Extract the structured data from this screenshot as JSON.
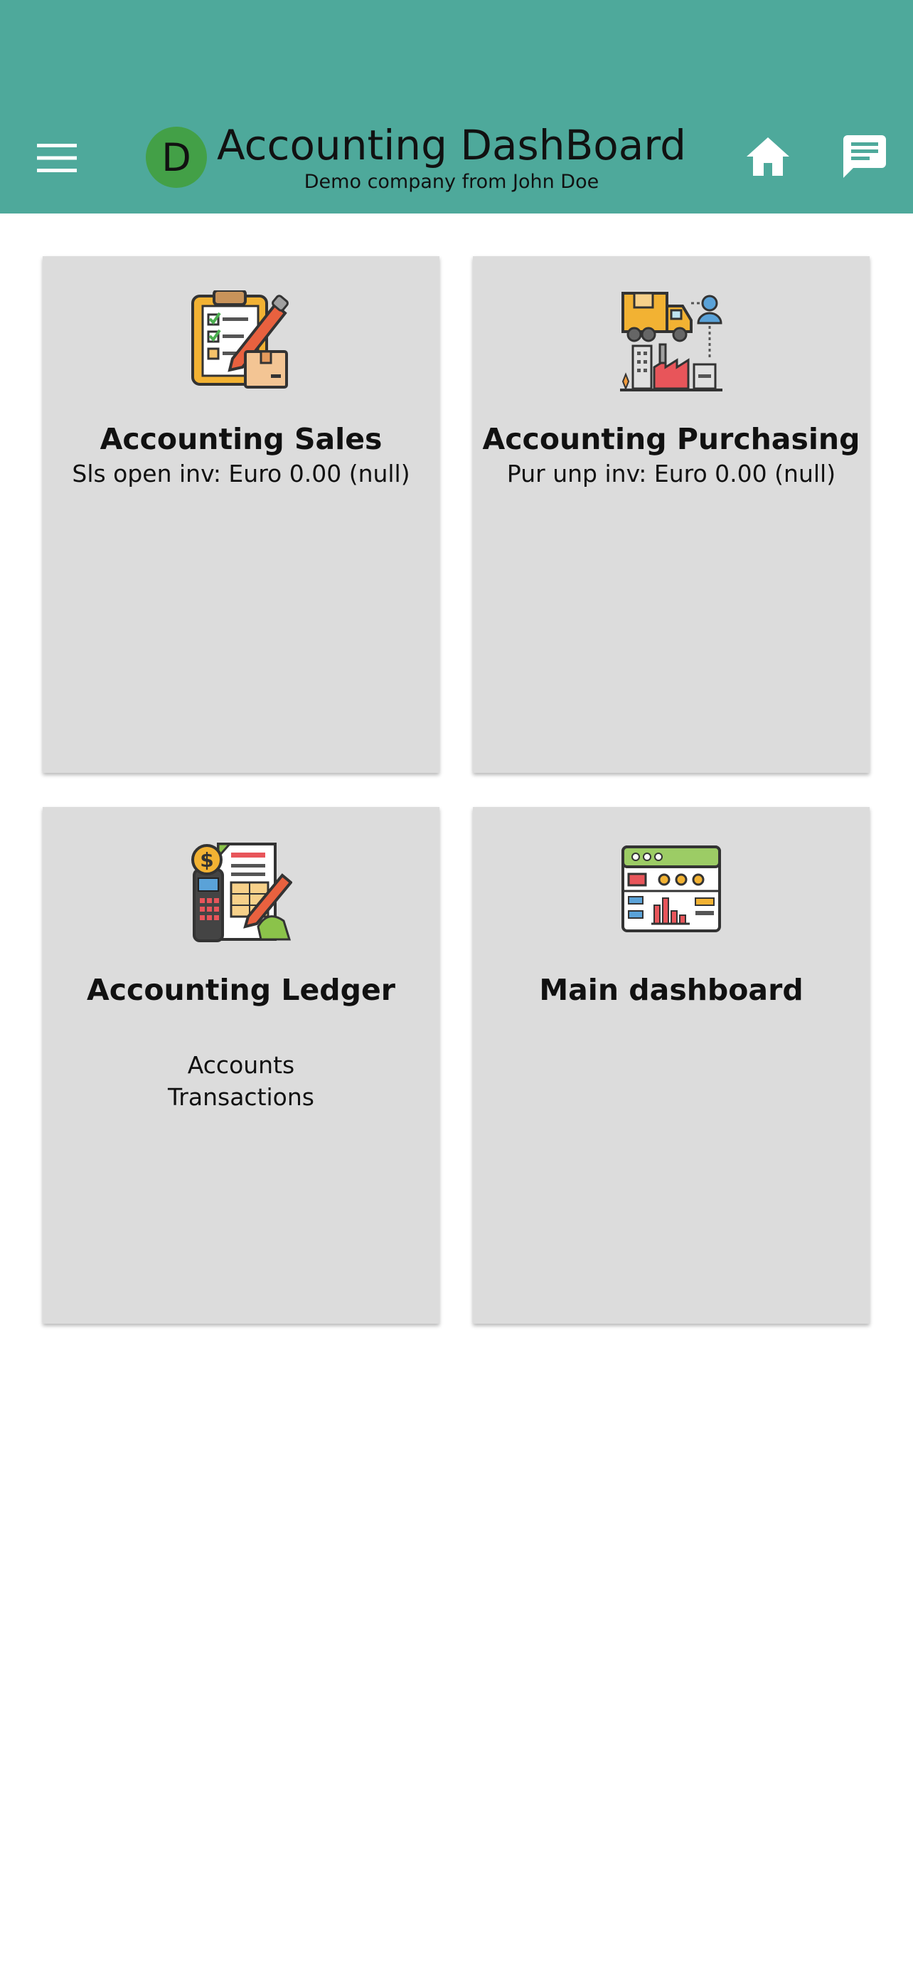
{
  "appbar": {
    "avatar_letter": "D",
    "title": "Accounting DashBoard",
    "subtitle": "Demo company from John Doe",
    "background_color": "#4ea99b",
    "avatar_color": "#43a047",
    "menu_icon": "menu-icon",
    "home_icon": "home-icon",
    "chat_icon": "chat-icon"
  },
  "cards": [
    {
      "title": "Accounting Sales",
      "subtitle": "Sls open inv: Euro 0.00 (null)",
      "icon": "clipboard-checklist-icon"
    },
    {
      "title": "Accounting Purchasing",
      "subtitle": "Pur unp inv: Euro 0.00 (null)",
      "icon": "delivery-truck-factory-icon"
    },
    {
      "title": "Accounting Ledger",
      "links": [
        "Accounts",
        "Transactions"
      ],
      "icon": "ledger-calculator-icon"
    },
    {
      "title": "Main dashboard",
      "icon": "dashboard-browser-icon"
    }
  ],
  "colors": {
    "card_background": "#dcdcdc"
  }
}
